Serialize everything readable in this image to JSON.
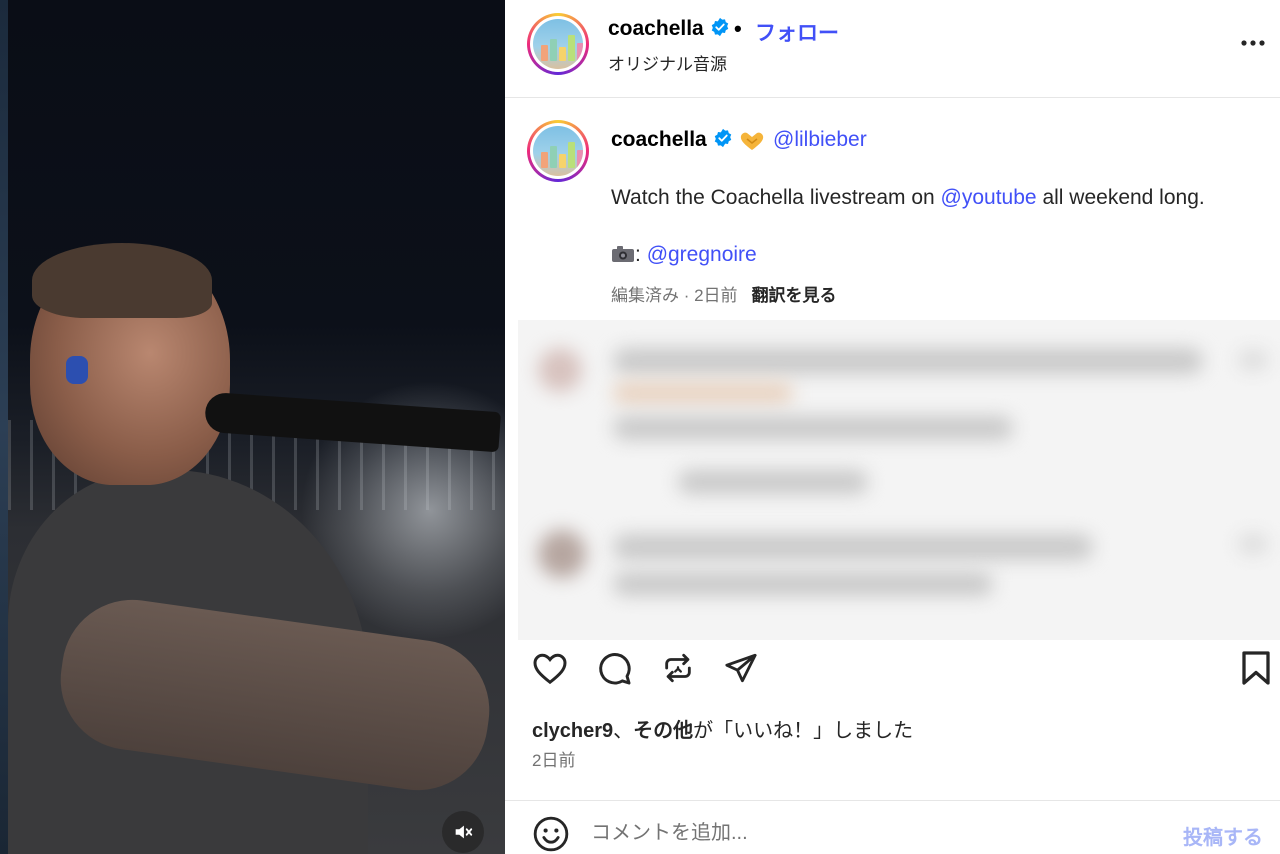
{
  "header": {
    "username": "coachella",
    "separator": "•",
    "follow_label": "フォロー",
    "audio_label": "オリジナル音源",
    "more_icon": "more-horizontal-icon"
  },
  "caption": {
    "username": "coachella",
    "mention": "@lilbieber",
    "text_before": "Watch the Coachella livestream on ",
    "text_link": "@youtube",
    "text_after": " all weekend long.",
    "photo_separator": ":",
    "photo_credit": "@gregnoire",
    "meta": "編集済み · 2日前",
    "translate_label": "翻訳を見る"
  },
  "actions": {
    "like_icon": "heart-icon",
    "comment_icon": "comment-icon",
    "repost_icon": "repost-icon",
    "share_icon": "send-icon",
    "save_icon": "bookmark-icon"
  },
  "likes": {
    "user": "clycher9",
    "mid": "、",
    "others": "その他",
    "suffix": "が「いいね！」しました"
  },
  "post_date": "2日前",
  "composer": {
    "placeholder": "コメントを追加...",
    "post_label": "投稿する"
  },
  "colors": {
    "accent": "#4150f7",
    "verified": "#0095f6",
    "muted": "#737373"
  }
}
